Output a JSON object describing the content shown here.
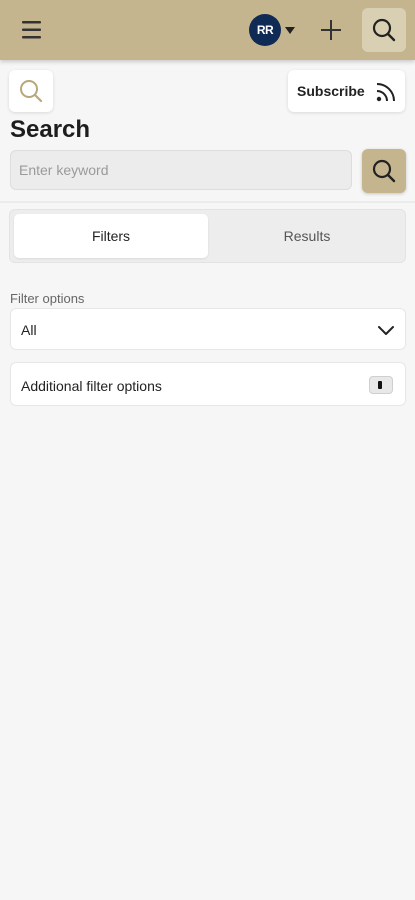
{
  "header": {
    "menu_icon": "hamburger-menu-icon",
    "user": {
      "initials": "RR",
      "avatar_color": "#0f2a55"
    },
    "add_icon": "plus-icon",
    "search_icon": "search-icon",
    "bar_color": "#c4b58e"
  },
  "toolbar": {
    "subscribe_label": "Subscribe",
    "subscribe_icon": "rss-feed-icon"
  },
  "search": {
    "title": "Search",
    "placeholder": "Enter keyword",
    "value": ""
  },
  "tabs": [
    {
      "label": "Filters",
      "active": true
    },
    {
      "label": "Results",
      "active": false
    }
  ],
  "filters": {
    "label": "Filter options",
    "selected": "All",
    "additional_label": "Additional filter options"
  }
}
